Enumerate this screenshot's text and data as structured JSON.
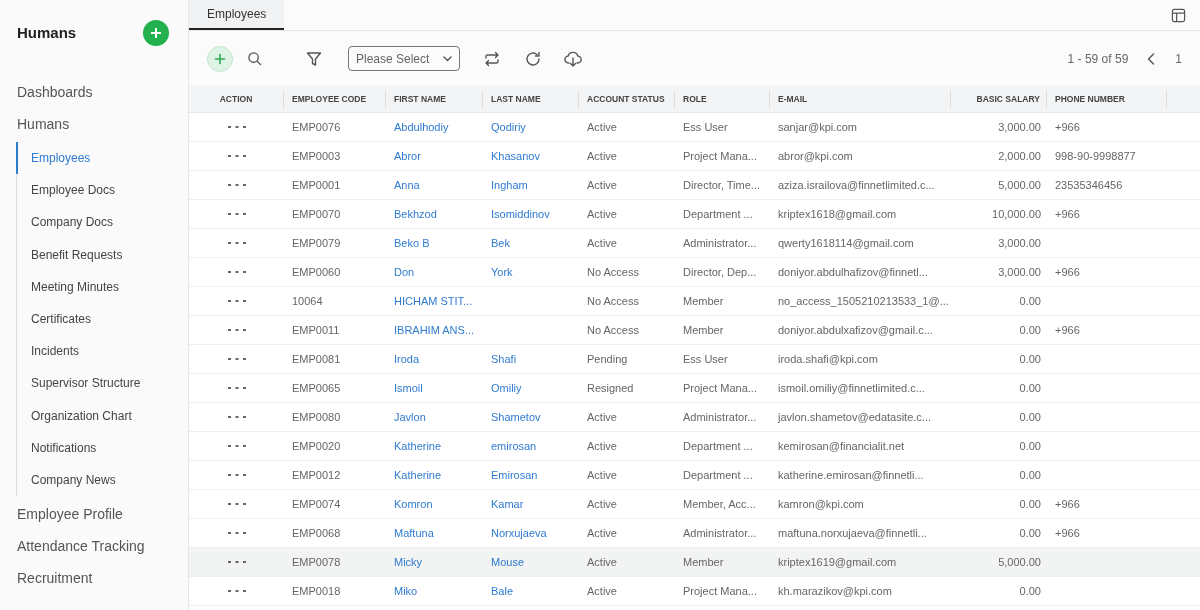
{
  "sidebar": {
    "title": "Humans",
    "items": [
      {
        "label": "Dashboards",
        "selected": false
      },
      {
        "label": "Humans",
        "selected": false,
        "children": [
          {
            "label": "Employees",
            "selected": true
          },
          {
            "label": "Employee Docs",
            "selected": false
          },
          {
            "label": "Company Docs",
            "selected": false
          },
          {
            "label": "Benefit Requests",
            "selected": false
          },
          {
            "label": "Meeting Minutes",
            "selected": false
          },
          {
            "label": "Certificates",
            "selected": false
          },
          {
            "label": "Incidents",
            "selected": false
          },
          {
            "label": "Supervisor Structure",
            "selected": false
          },
          {
            "label": "Organization Chart",
            "selected": false
          },
          {
            "label": "Notifications",
            "selected": false
          },
          {
            "label": "Company News",
            "selected": false
          }
        ]
      },
      {
        "label": "Employee Profile",
        "selected": false
      },
      {
        "label": "Attendance Tracking",
        "selected": false
      },
      {
        "label": "Recruitment",
        "selected": false
      }
    ]
  },
  "tabs": [
    {
      "label": "Employees",
      "selected": true
    }
  ],
  "toolbar": {
    "select": {
      "placeholder": "Please Select"
    },
    "pagination": {
      "range": "1 - 59 of 59",
      "page": "1"
    }
  },
  "table": {
    "columns": [
      "ACTION",
      "EMPLOYEE CODE",
      "FIRST NAME",
      "LAST NAME",
      "ACCOUNT STATUS",
      "ROLE",
      "E-MAIL",
      "BASIC SALARY",
      "PHONE NUMBER"
    ],
    "rows": [
      {
        "hovered": false,
        "cells": [
          "",
          "EMP0076",
          "Abdulhodiy",
          "Qodiriy",
          "Active",
          "Ess User",
          "sanjar@kpi.com",
          "3,000.00",
          "+966"
        ]
      },
      {
        "hovered": false,
        "cells": [
          "",
          "EMP0003",
          "Abror",
          "Khasanov",
          "Active",
          "Project Mana...",
          "abror@kpi.com",
          "2,000.00",
          "998-90-9998877"
        ]
      },
      {
        "hovered": false,
        "cells": [
          "",
          "EMP0001",
          "Anna",
          "Ingham",
          "Active",
          "Director, Time...",
          "aziza.israilova@finnetlimited.c...",
          "5,000.00",
          "23535346456"
        ]
      },
      {
        "hovered": false,
        "cells": [
          "",
          "EMP0070",
          "Bekhzod",
          "Isomiddinov",
          "Active",
          "Department ...",
          "kriptex1618@gmail.com",
          "10,000.00",
          "+966"
        ]
      },
      {
        "hovered": false,
        "cells": [
          "",
          "EMP0079",
          "Beko B",
          "Bek",
          "Active",
          "Administrator...",
          "qwerty1618114@gmail.com",
          "3,000.00",
          ""
        ]
      },
      {
        "hovered": false,
        "cells": [
          "",
          "EMP0060",
          "Don",
          "York",
          "No Access",
          "Director, Dep...",
          "doniyor.abdulhafizov@finnetl...",
          "3,000.00",
          "+966"
        ]
      },
      {
        "hovered": false,
        "cells": [
          "",
          "10064",
          "HICHAM STIT...",
          "",
          "No Access",
          "Member",
          "no_access_1505210213533_1@...",
          "0.00",
          ""
        ]
      },
      {
        "hovered": false,
        "cells": [
          "",
          "EMP0011",
          "IBRAHIM ANS...",
          "",
          "No Access",
          "Member",
          "doniyor.abdulxafizov@gmail.c...",
          "0.00",
          "+966"
        ]
      },
      {
        "hovered": false,
        "cells": [
          "",
          "EMP0081",
          "Iroda",
          "Shafi",
          "Pending",
          "Ess User",
          "iroda.shafi@kpi.com",
          "0.00",
          ""
        ]
      },
      {
        "hovered": false,
        "cells": [
          "",
          "EMP0065",
          "Ismoil",
          "Omiliy",
          "Resigned",
          "Project Mana...",
          "ismoil.omiliy@finnetlimited.c...",
          "0.00",
          ""
        ]
      },
      {
        "hovered": false,
        "cells": [
          "",
          "EMP0080",
          "Javlon",
          "Shametov",
          "Active",
          "Administrator...",
          "javlon.shametov@edatasite.c...",
          "0.00",
          ""
        ]
      },
      {
        "hovered": false,
        "cells": [
          "",
          "EMP0020",
          "Katherine",
          "emirosan",
          "Active",
          "Department ...",
          "kemirosan@financialit.net",
          "0.00",
          ""
        ]
      },
      {
        "hovered": false,
        "cells": [
          "",
          "EMP0012",
          "Katherine",
          "Emirosan",
          "Active",
          "Department ...",
          "katherine.emirosan@finnetli...",
          "0.00",
          ""
        ]
      },
      {
        "hovered": false,
        "cells": [
          "",
          "EMP0074",
          "Komron",
          "Kamar",
          "Active",
          "Member, Acc...",
          "kamron@kpi.com",
          "0.00",
          "+966"
        ]
      },
      {
        "hovered": false,
        "cells": [
          "",
          "EMP0068",
          "Maftuna",
          "Norxujaeva",
          "Active",
          "Administrator...",
          "maftuna.norxujaeva@finnetli...",
          "0.00",
          "+966"
        ]
      },
      {
        "hovered": true,
        "cells": [
          "",
          "EMP0078",
          "Micky",
          "Mouse",
          "Active",
          "Member",
          "kriptex1619@gmail.com",
          "5,000.00",
          ""
        ]
      },
      {
        "hovered": false,
        "cells": [
          "",
          "EMP0018",
          "Miko",
          "Bale",
          "Active",
          "Project Mana...",
          "kh.marazikov@kpi.com",
          "0.00",
          ""
        ]
      }
    ]
  }
}
